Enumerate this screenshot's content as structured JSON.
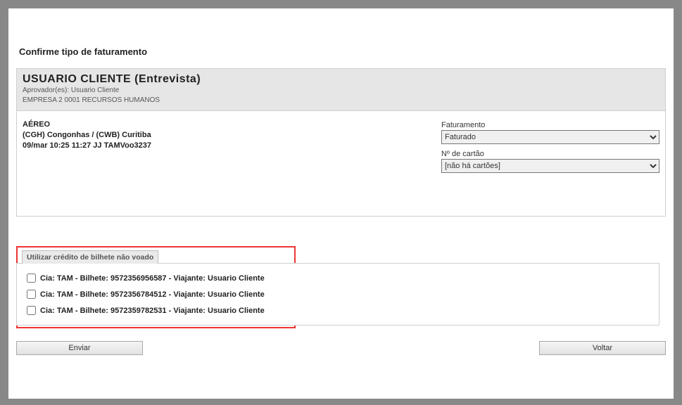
{
  "title": "Confirme tipo de faturamento",
  "header": {
    "main": "USUARIO CLIENTE   (Entrevista)",
    "approver_line": "Aprovador(es): Usuario Cliente",
    "company_line": "EMPRESA 2 0001 RECURSOS HUMANOS"
  },
  "flight": {
    "product": "AÉREO",
    "route": "(CGH) Congonhas / (CWB) Curitiba",
    "detail": "09/mar 10:25 11:27 JJ TAMVoo3237"
  },
  "billing": {
    "label": "Faturamento",
    "value": "Faturado",
    "card_label": "Nº de cartão",
    "card_value": "[não há cartões]"
  },
  "credit": {
    "tab": "Utilizar crédito de bilhete não voado",
    "items": [
      "Cia: TAM - Bilhete: 9572356956587 - Viajante: Usuario Cliente",
      "Cia: TAM - Bilhete: 9572356784512 - Viajante: Usuario Cliente",
      "Cia: TAM - Bilhete: 9572359782531 - Viajante: Usuario Cliente"
    ]
  },
  "buttons": {
    "send": "Enviar",
    "back": "Voltar"
  }
}
